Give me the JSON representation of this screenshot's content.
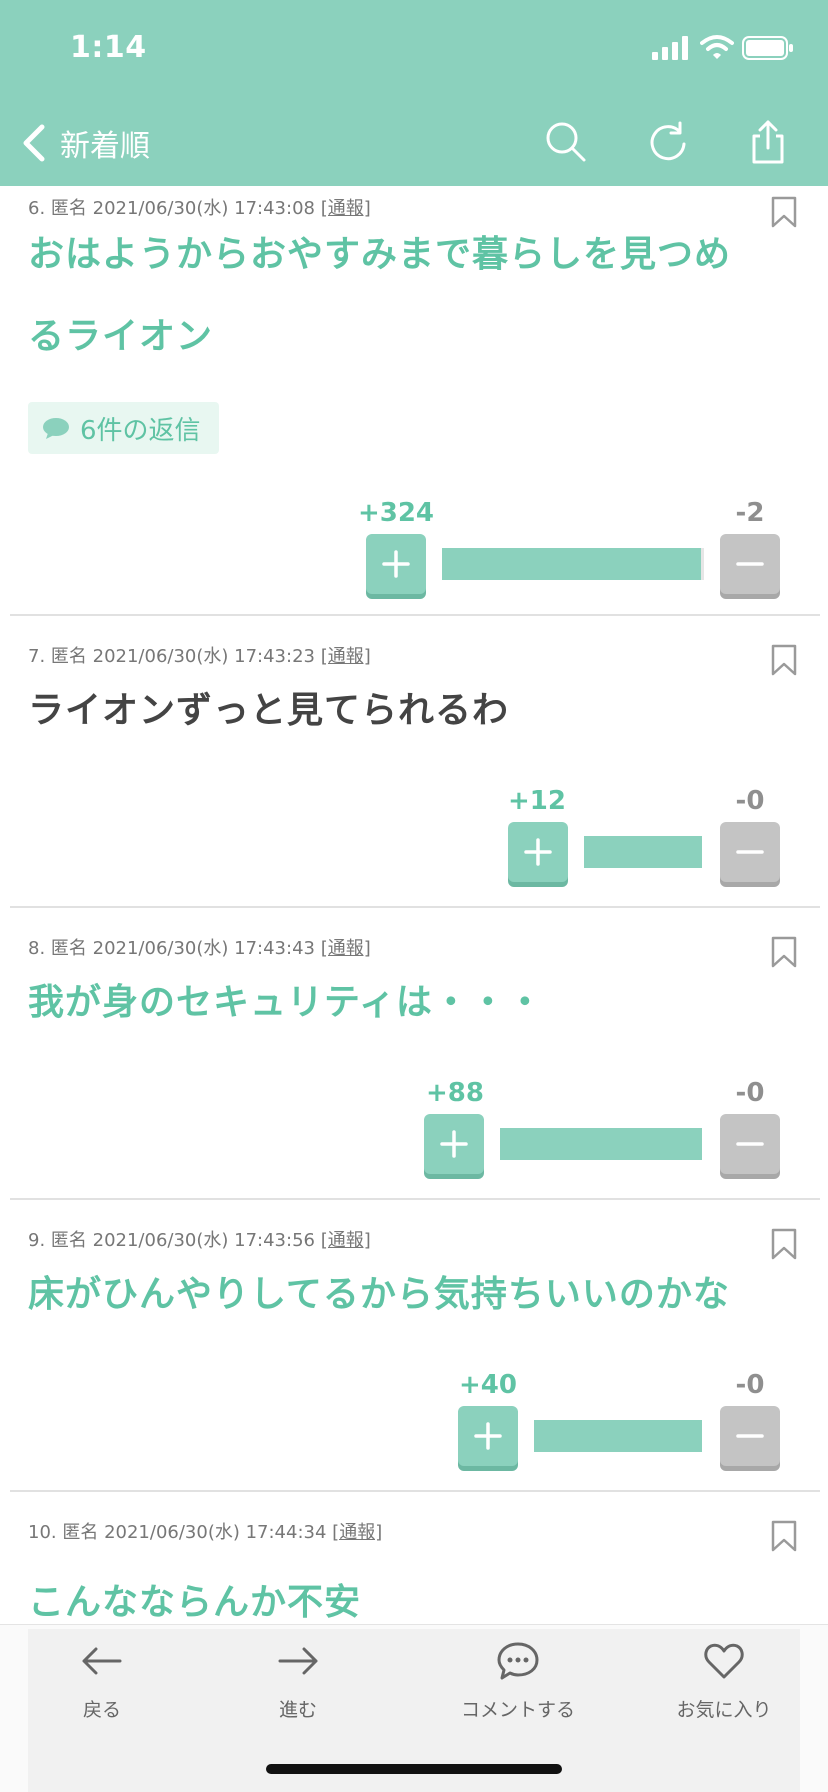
{
  "status_bar": {
    "time": "1:14"
  },
  "nav": {
    "back_label": "新着順",
    "icons": [
      "search-icon",
      "refresh-icon",
      "share-icon"
    ]
  },
  "colors": {
    "accent": "#8bd1bd",
    "accent_text": "#5fc3a4",
    "minus": "#c4c4c4"
  },
  "comments": [
    {
      "meta": "6. 匿名 2021/06/30(水) 17:43:08",
      "report": "[通報]",
      "line1": "おはようからおやすみまで暮らしを見つめ",
      "line2": "るライオン",
      "replies": "6件の返信",
      "plus": "+324",
      "minus": "-2",
      "plus_fraction": 0.99
    },
    {
      "meta": "7. 匿名 2021/06/30(水) 17:43:23",
      "report": "[通報]",
      "line1": "ライオンずっと見てられるわ",
      "plus": "+12",
      "minus": "-0",
      "plus_fraction": 1.0
    },
    {
      "meta": "8. 匿名 2021/06/30(水) 17:43:43",
      "report": "[通報]",
      "line1": "我が身のセキュリティは・・・",
      "plus": "+88",
      "minus": "-0",
      "plus_fraction": 1.0
    },
    {
      "meta": "9. 匿名 2021/06/30(水) 17:43:56",
      "report": "[通報]",
      "line1": "床がひんやりしてるから気持ちいいのかな",
      "plus": "+40",
      "minus": "-0",
      "plus_fraction": 1.0
    },
    {
      "meta": "10. 匿名 2021/06/30(水) 17:44:34",
      "report": "[通報]",
      "line1": "こんなならんか不安"
    }
  ],
  "toolbar": {
    "back": "戻る",
    "forward": "進む",
    "comment": "コメントする",
    "favorite": "お気に入り"
  }
}
